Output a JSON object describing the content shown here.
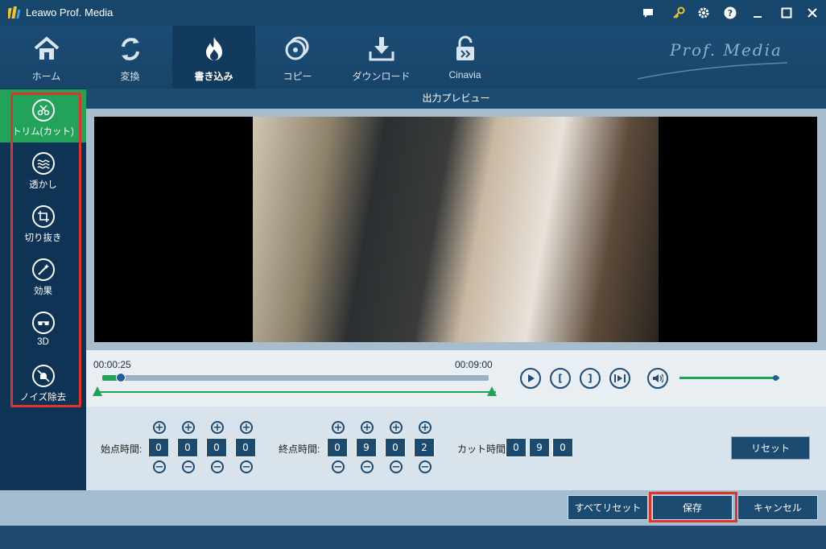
{
  "app": {
    "title": "Leawo Prof. Media",
    "brand": "Prof. Media"
  },
  "nav": {
    "tabs": [
      {
        "label": "ホーム",
        "icon": "home-icon"
      },
      {
        "label": "変換",
        "icon": "convert-icon"
      },
      {
        "label": "書き込み",
        "icon": "burn-icon",
        "active": true
      },
      {
        "label": "コピー",
        "icon": "disc-copy-icon"
      },
      {
        "label": "ダウンロード",
        "icon": "download-icon"
      },
      {
        "label": "Cinavia",
        "icon": "unlock-icon"
      }
    ]
  },
  "sidebar": {
    "items": [
      {
        "label": "トリム(カット)",
        "icon": "scissors-icon",
        "active": true
      },
      {
        "label": "透かし",
        "icon": "watermark-icon"
      },
      {
        "label": "切り抜き",
        "icon": "crop-icon"
      },
      {
        "label": "効果",
        "icon": "effect-wand-icon"
      },
      {
        "label": "3D",
        "icon": "3d-glasses-icon"
      },
      {
        "label": "ノイズ除去",
        "icon": "denoise-icon"
      }
    ]
  },
  "preview": {
    "header": "出力プレビュー"
  },
  "playback": {
    "start_time": "00:00:25",
    "end_time": "00:09:00",
    "progress_fraction": 0.047,
    "volume_fraction": 0.96
  },
  "trim": {
    "start_label": "始点時間:",
    "start_digits": [
      "0",
      "0",
      "0",
      "0"
    ],
    "end_label": "終点時間:",
    "end_digits": [
      "0",
      "9",
      "0",
      "2"
    ],
    "cut_label": "カット時間:",
    "cut_digits": [
      "0",
      "9",
      "0"
    ],
    "reset_label": "リセット"
  },
  "footer": {
    "reset_all_label": "すべてリセット",
    "save_label": "保存",
    "cancel_label": "キャンセル"
  },
  "colors": {
    "accent_green": "#21a35a",
    "highlight_red": "#e2332b",
    "navy": "#1c4b71"
  }
}
